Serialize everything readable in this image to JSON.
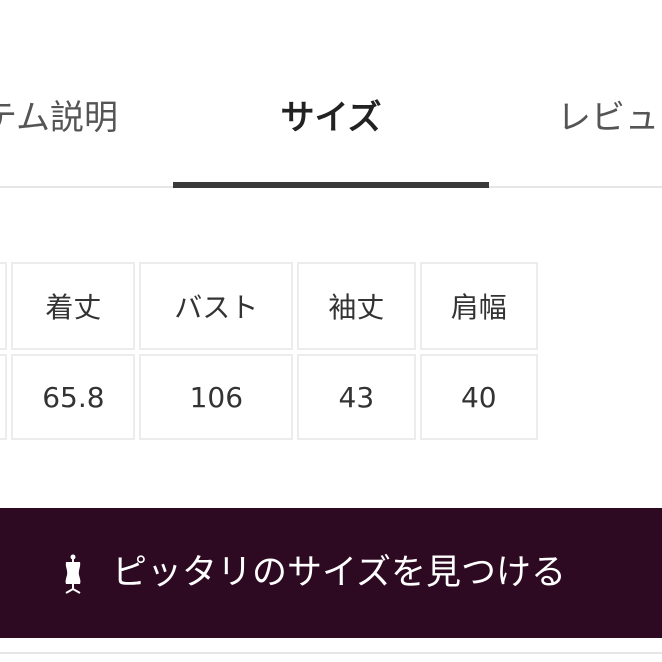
{
  "tabs": {
    "items": [
      {
        "label": "テム説明"
      },
      {
        "label": "サイズ"
      },
      {
        "label": "レビュ"
      }
    ],
    "active_index": 1
  },
  "size_table": {
    "headers": [
      "",
      "着丈",
      "バスト",
      "袖丈",
      "肩幅"
    ],
    "values": [
      "",
      "65.8",
      "106",
      "43",
      "40"
    ]
  },
  "cta": {
    "label": "ピッタリのサイズを見つける",
    "icon": "dress-form-icon",
    "background": "#2e0a22"
  },
  "colors": {
    "active_tab_underline": "#3a3a3a",
    "text": "#333333",
    "cell_border": "#ececec"
  }
}
